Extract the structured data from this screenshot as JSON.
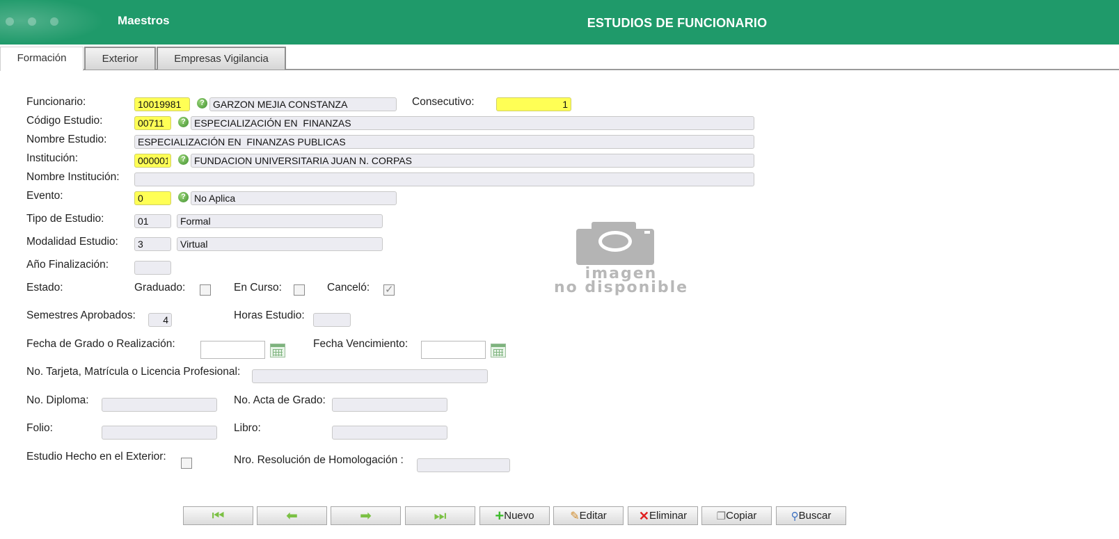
{
  "header": {
    "app_title": "Maestros",
    "form_title": "ESTUDIOS DE FUNCIONARIO"
  },
  "tabs": [
    {
      "label": "Formación"
    },
    {
      "label": "Exterior"
    },
    {
      "label": "Empresas Vigilancia"
    }
  ],
  "form": {
    "funcionario": {
      "label": "Funcionario:",
      "code": "10019981",
      "name": "GARZON MEJIA CONSTANZA"
    },
    "consecutivo": {
      "label": "Consecutivo:",
      "value": "1"
    },
    "codigo_estudio": {
      "label": "Código Estudio:",
      "code": "00711",
      "name": "ESPECIALIZACIÓN EN  FINANZAS"
    },
    "nombre_estudio": {
      "label": "Nombre Estudio:",
      "value": "ESPECIALIZACIÓN EN  FINANZAS PUBLICAS"
    },
    "institucion": {
      "label": "Institución:",
      "code": "000001",
      "name": "FUNDACION UNIVERSITARIA JUAN N. CORPAS"
    },
    "nombre_institucion": {
      "label": "Nombre Institución:",
      "value": ""
    },
    "evento": {
      "label": "Evento:",
      "code": "0",
      "name": "No Aplica"
    },
    "tipo_estudio": {
      "label": "Tipo de Estudio:",
      "code": "01",
      "name": "Formal"
    },
    "modalidad_estudio": {
      "label": "Modalidad Estudio:",
      "code": "3",
      "name": "Virtual"
    },
    "anio_finalizacion": {
      "label": "Año Finalización:",
      "value": ""
    },
    "estado": {
      "label": "Estado:",
      "graduado": {
        "label": "Graduado:",
        "checked": false
      },
      "en_curso": {
        "label": "En Curso:",
        "checked": false
      },
      "cancelo": {
        "label": "Canceló:",
        "checked": true
      }
    },
    "semestres_aprobados": {
      "label": "Semestres Aprobados:",
      "value": "4"
    },
    "horas_estudio": {
      "label": "Horas Estudio:",
      "value": ""
    },
    "fecha_grado": {
      "label": "Fecha de Grado o Realización:",
      "value": ""
    },
    "fecha_vencimiento": {
      "label": "Fecha Vencimiento:",
      "value": ""
    },
    "tarjeta_profesional": {
      "label": "No. Tarjeta, Matrícula o Licencia Profesional:",
      "value": ""
    },
    "diploma": {
      "label": "No. Diploma:",
      "value": ""
    },
    "acta_grado": {
      "label": "No. Acta de Grado:",
      "value": ""
    },
    "folio": {
      "label": "Folio:",
      "value": ""
    },
    "libro": {
      "label": "Libro:",
      "value": ""
    },
    "estudio_exterior": {
      "label": "Estudio Hecho en el Exterior:",
      "checked": false
    },
    "resolucion_homologacion": {
      "label": "Nro. Resolución de Homologación :",
      "value": ""
    }
  },
  "image_placeholder": {
    "line1": "imagen",
    "line2": "no disponible"
  },
  "toolbar": {
    "nuevo": "Nuevo",
    "editar": "Editar",
    "eliminar": "Eliminar",
    "copiar": "Copiar",
    "buscar": "Buscar"
  },
  "colors": {
    "header": "#1f9a6a",
    "required_field": "#ffff55"
  }
}
